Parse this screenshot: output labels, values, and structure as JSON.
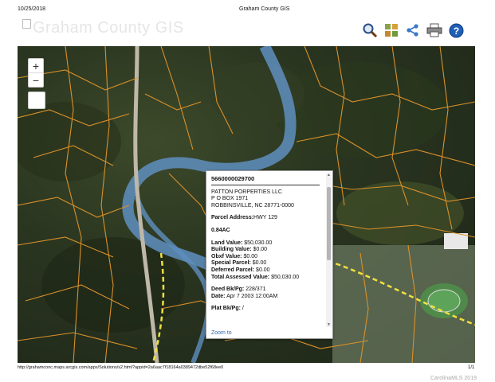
{
  "header": {
    "date": "10/25/2018",
    "title": "Graham County GIS"
  },
  "logo": {
    "text": "Graham County GIS"
  },
  "toolbar": [
    {
      "name": "magnifier-icon"
    },
    {
      "name": "layers-grid-icon"
    },
    {
      "name": "share-icon"
    },
    {
      "name": "print-icon"
    },
    {
      "name": "help-icon"
    }
  ],
  "zoom": {
    "in": "+",
    "out": "−"
  },
  "popup": {
    "parcel_id": "5660000029700",
    "owner": "PATTON PORPERTIES LLC",
    "address1": "P O BOX 1971",
    "address2": "ROBBINSVILLE, NC  28771-0000",
    "parcel_address_label": "Parcel Address:",
    "parcel_address": "HWY 129",
    "acreage": "0.84AC",
    "land_label": "Land Value:",
    "land_value": "$50,030.00",
    "building_label": "Building Value:",
    "building_value": "$0.00",
    "obxf_label": "Obxf Value:",
    "obxf_value": "$0.00",
    "special_label": "Special Parcel:",
    "special_value": "$0.00",
    "deferred_label": "Deferred Parcel:",
    "deferred_value": "$0.00",
    "total_label": "Total Assessed Value:",
    "total_value": "$50,030.00",
    "deed_label": "Deed Bk/Pg:",
    "deed_value": "228/371",
    "date_label": "Date:",
    "date_value": "Apr 7 2003 12:00AM",
    "plat_label": "Plat Bk/Pg:",
    "plat_value": "/",
    "zoom_to": "Zoom to"
  },
  "footer": {
    "url": "http://grahamconc.maps.arcgis.com/apps/Solutions/s2.html?appid=2a6aac7f18164a0389472dbe52f68ee0",
    "page": "1/1"
  },
  "watermark": "CarolinaMLS 2019",
  "colors": {
    "parcel_lines": "#d9902a",
    "river": "#5f8fc0",
    "road_highlight": "#f0e040",
    "popup_link": "#3366aa"
  }
}
